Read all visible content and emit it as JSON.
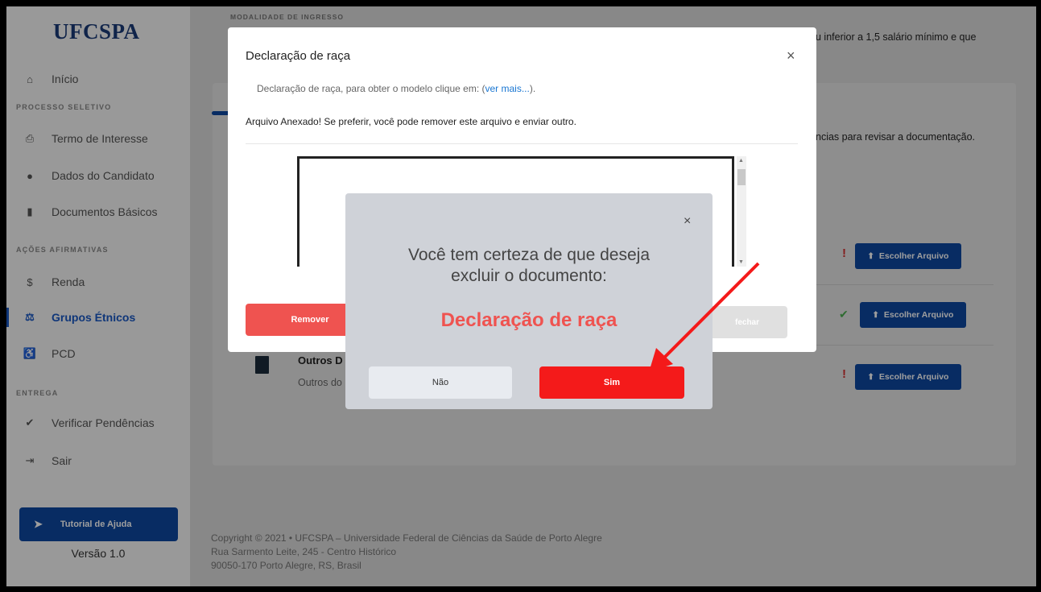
{
  "sidebar": {
    "logo": "UFCSPA",
    "items": [
      {
        "label": "Início",
        "icon": "home-icon",
        "glyph": "⌂"
      },
      {
        "label": "Termo de Interesse",
        "icon": "print-icon",
        "glyph": "⎙"
      },
      {
        "label": "Dados do Candidato",
        "icon": "user-icon",
        "glyph": "●"
      },
      {
        "label": "Documentos Básicos",
        "icon": "file-icon",
        "glyph": "▮"
      },
      {
        "label": "Renda",
        "icon": "dollar-icon",
        "glyph": "$"
      },
      {
        "label": "Grupos Étnicos",
        "icon": "balance-icon",
        "glyph": "⚖"
      },
      {
        "label": "PCD",
        "icon": "wheelchair-icon",
        "glyph": "♿"
      },
      {
        "label": "Verificar Pendências",
        "icon": "check-icon",
        "glyph": "✔"
      },
      {
        "label": "Sair",
        "icon": "sign-out-icon",
        "glyph": "⇥"
      }
    ],
    "sections": {
      "processo": "PROCESSO SELETIVO",
      "acoes": "AÇÕES AFIRMATIVAS",
      "entrega": "ENTREGA"
    },
    "tutorial": "Tutorial de Ajuda",
    "version": "Versão 1.0"
  },
  "main": {
    "modalidade_label": "MODALIDADE DE INGRESSO",
    "bg_text_1": "u inferior a 1,5 salário mínimo e que",
    "bg_text_2": "ncias para revisar a documentação.",
    "choose_label": "Escolher Arquivo",
    "doc_title": "Outros D",
    "doc_sub": "Outros do"
  },
  "footer": {
    "line1": "Copyright © 2021  •  UFCSPA – Universidade Federal de Ciências da Saúde de Porto Alegre",
    "line2": "Rua Sarmento Leite, 245 - Centro Histórico",
    "line3": "90050-170 Porto Alegre, RS, Brasil"
  },
  "modal": {
    "title": "Declaração de raça",
    "close": "×",
    "desc_prefix": "Declaração de raça, para obter o modelo clique em: (",
    "desc_link": "ver mais...",
    "desc_suffix": ").",
    "note": "Arquivo Anexado! Se preferir, você pode remover este arquivo e enviar outro.",
    "remove_label": "Remover",
    "close_label": "fechar"
  },
  "confirm": {
    "close": "×",
    "question": "Você tem certeza de que deseja excluir o documento:",
    "document": "Declaração de raça",
    "no_label": "Não",
    "yes_label": "Sim"
  },
  "colors": {
    "brand": "#0d47a1",
    "danger": "#f41a1a",
    "accent_text": "#ef5350"
  }
}
